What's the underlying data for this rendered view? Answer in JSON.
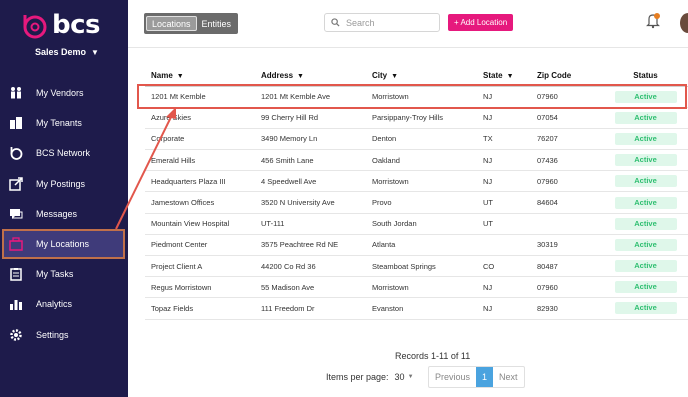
{
  "brand": {
    "name": "bcs",
    "org": "Sales Demo"
  },
  "sidebar": {
    "items": [
      {
        "label": "My Vendors",
        "icon": "vendors-icon"
      },
      {
        "label": "My Tenants",
        "icon": "tenants-icon"
      },
      {
        "label": "BCS Network",
        "icon": "network-icon"
      },
      {
        "label": "My Postings",
        "icon": "postings-icon"
      },
      {
        "label": "Messages",
        "icon": "messages-icon"
      },
      {
        "label": "My Locations",
        "icon": "locations-icon",
        "active": true
      },
      {
        "label": "My Tasks",
        "icon": "tasks-icon"
      },
      {
        "label": "Analytics",
        "icon": "analytics-icon"
      },
      {
        "label": "Settings",
        "icon": "settings-icon"
      }
    ]
  },
  "topbar": {
    "tabs": [
      "Locations",
      "Entities"
    ],
    "search_placeholder": "Search",
    "add_label": "+ Add Location"
  },
  "table": {
    "headers": {
      "name": "Name",
      "address": "Address",
      "city": "City",
      "state": "State",
      "zip": "Zip Code",
      "status": "Status"
    },
    "rows": [
      {
        "name": "1201 Mt Kemble",
        "address": "1201 Mt Kemble Ave",
        "city": "Morristown",
        "state": "NJ",
        "zip": "07960",
        "status": "Active"
      },
      {
        "name": "Azure Skies",
        "address": "99 Cherry Hill Rd",
        "city": "Parsippany-Troy Hills",
        "state": "NJ",
        "zip": "07054",
        "status": "Active"
      },
      {
        "name": "Corporate",
        "address": "3490 Memory Ln",
        "city": "Denton",
        "state": "TX",
        "zip": "76207",
        "status": "Active"
      },
      {
        "name": "Emerald Hills",
        "address": "456 Smith Lane",
        "city": "Oakland",
        "state": "NJ",
        "zip": "07436",
        "status": "Active"
      },
      {
        "name": "Headquarters Plaza III",
        "address": "4 Speedwell Ave",
        "city": "Morristown",
        "state": "NJ",
        "zip": "07960",
        "status": "Active"
      },
      {
        "name": "Jamestown Offices",
        "address": "3520 N University Ave",
        "city": "Provo",
        "state": "UT",
        "zip": "84604",
        "status": "Active"
      },
      {
        "name": "Mountain View Hospital",
        "address": "UT-111",
        "city": "South Jordan",
        "state": "UT",
        "zip": "",
        "status": "Active"
      },
      {
        "name": "Piedmont Center",
        "address": "3575 Peachtree Rd NE",
        "city": "Atlanta",
        "state": "",
        "zip": "30319",
        "status": "Active"
      },
      {
        "name": "Project Client A",
        "address": "44200 Co Rd 36",
        "city": "Steamboat Springs",
        "state": "CO",
        "zip": "80487",
        "status": "Active"
      },
      {
        "name": "Regus Morristown",
        "address": "55 Madison Ave",
        "city": "Morristown",
        "state": "NJ",
        "zip": "07960",
        "status": "Active"
      },
      {
        "name": "Topaz Fields",
        "address": "111 Freedom Dr",
        "city": "Evanston",
        "state": "NJ",
        "zip": "82930",
        "status": "Active"
      }
    ]
  },
  "footer": {
    "records": "Records 1-11 of 11",
    "items_per_page_label": "Items per page:",
    "items_per_page": "30",
    "previous": "Previous",
    "page": "1",
    "next": "Next"
  },
  "colors": {
    "sidebar": "#1e1b4b",
    "accent": "#e6197d",
    "active_badge": "#2fbf71",
    "highlight": "#e2574c"
  }
}
